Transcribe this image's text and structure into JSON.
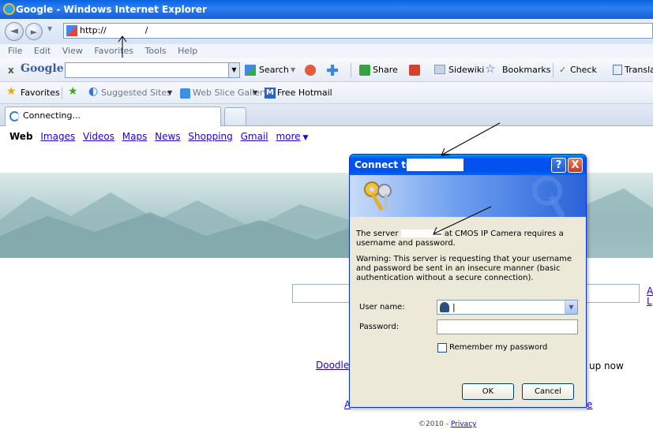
{
  "window": {
    "title": "Google - Windows Internet Explorer"
  },
  "address": {
    "value": "http://              /"
  },
  "menu": [
    "File",
    "Edit",
    "View",
    "Favorites",
    "Tools",
    "Help"
  ],
  "google_toolbar": {
    "close": "x",
    "logo": "Google",
    "search_label": "Search",
    "share_label": "Share",
    "sidewiki_label": "Sidewiki",
    "bookmarks_label": "Bookmarks",
    "check_label": "Check",
    "translate_label": "Translate"
  },
  "favorites_bar": {
    "favorites": "Favorites",
    "suggested": "Suggested Sites",
    "webslice": "Web Slice Gallery",
    "hotmail": "Free Hotmail"
  },
  "tab": {
    "label": "Connecting..."
  },
  "google_nav": {
    "current": "Web",
    "links": [
      "Images",
      "Videos",
      "Maps",
      "News",
      "Shopping",
      "Gmail",
      "more"
    ]
  },
  "page": {
    "doodle_link": "Doodle",
    "signup_text": "up now",
    "side_a": "A",
    "side_l": "L",
    "bottom_a": "A",
    "bottom_e": "e",
    "footer_copy": "©2010 -",
    "footer_privacy": "Privacy"
  },
  "dialog": {
    "title": "Connect to",
    "help": "?",
    "close": "X",
    "server_pre": "The server",
    "server_post": "at CMOS IP Camera requires a username and password.",
    "warning": "Warning: This server is requesting that your username and password be sent in an insecure manner (basic authentication without a secure connection).",
    "username_label": "User name:",
    "username_value": "|",
    "password_label": "Password:",
    "remember_label": "Remember my password",
    "ok": "OK",
    "cancel": "Cancel"
  }
}
